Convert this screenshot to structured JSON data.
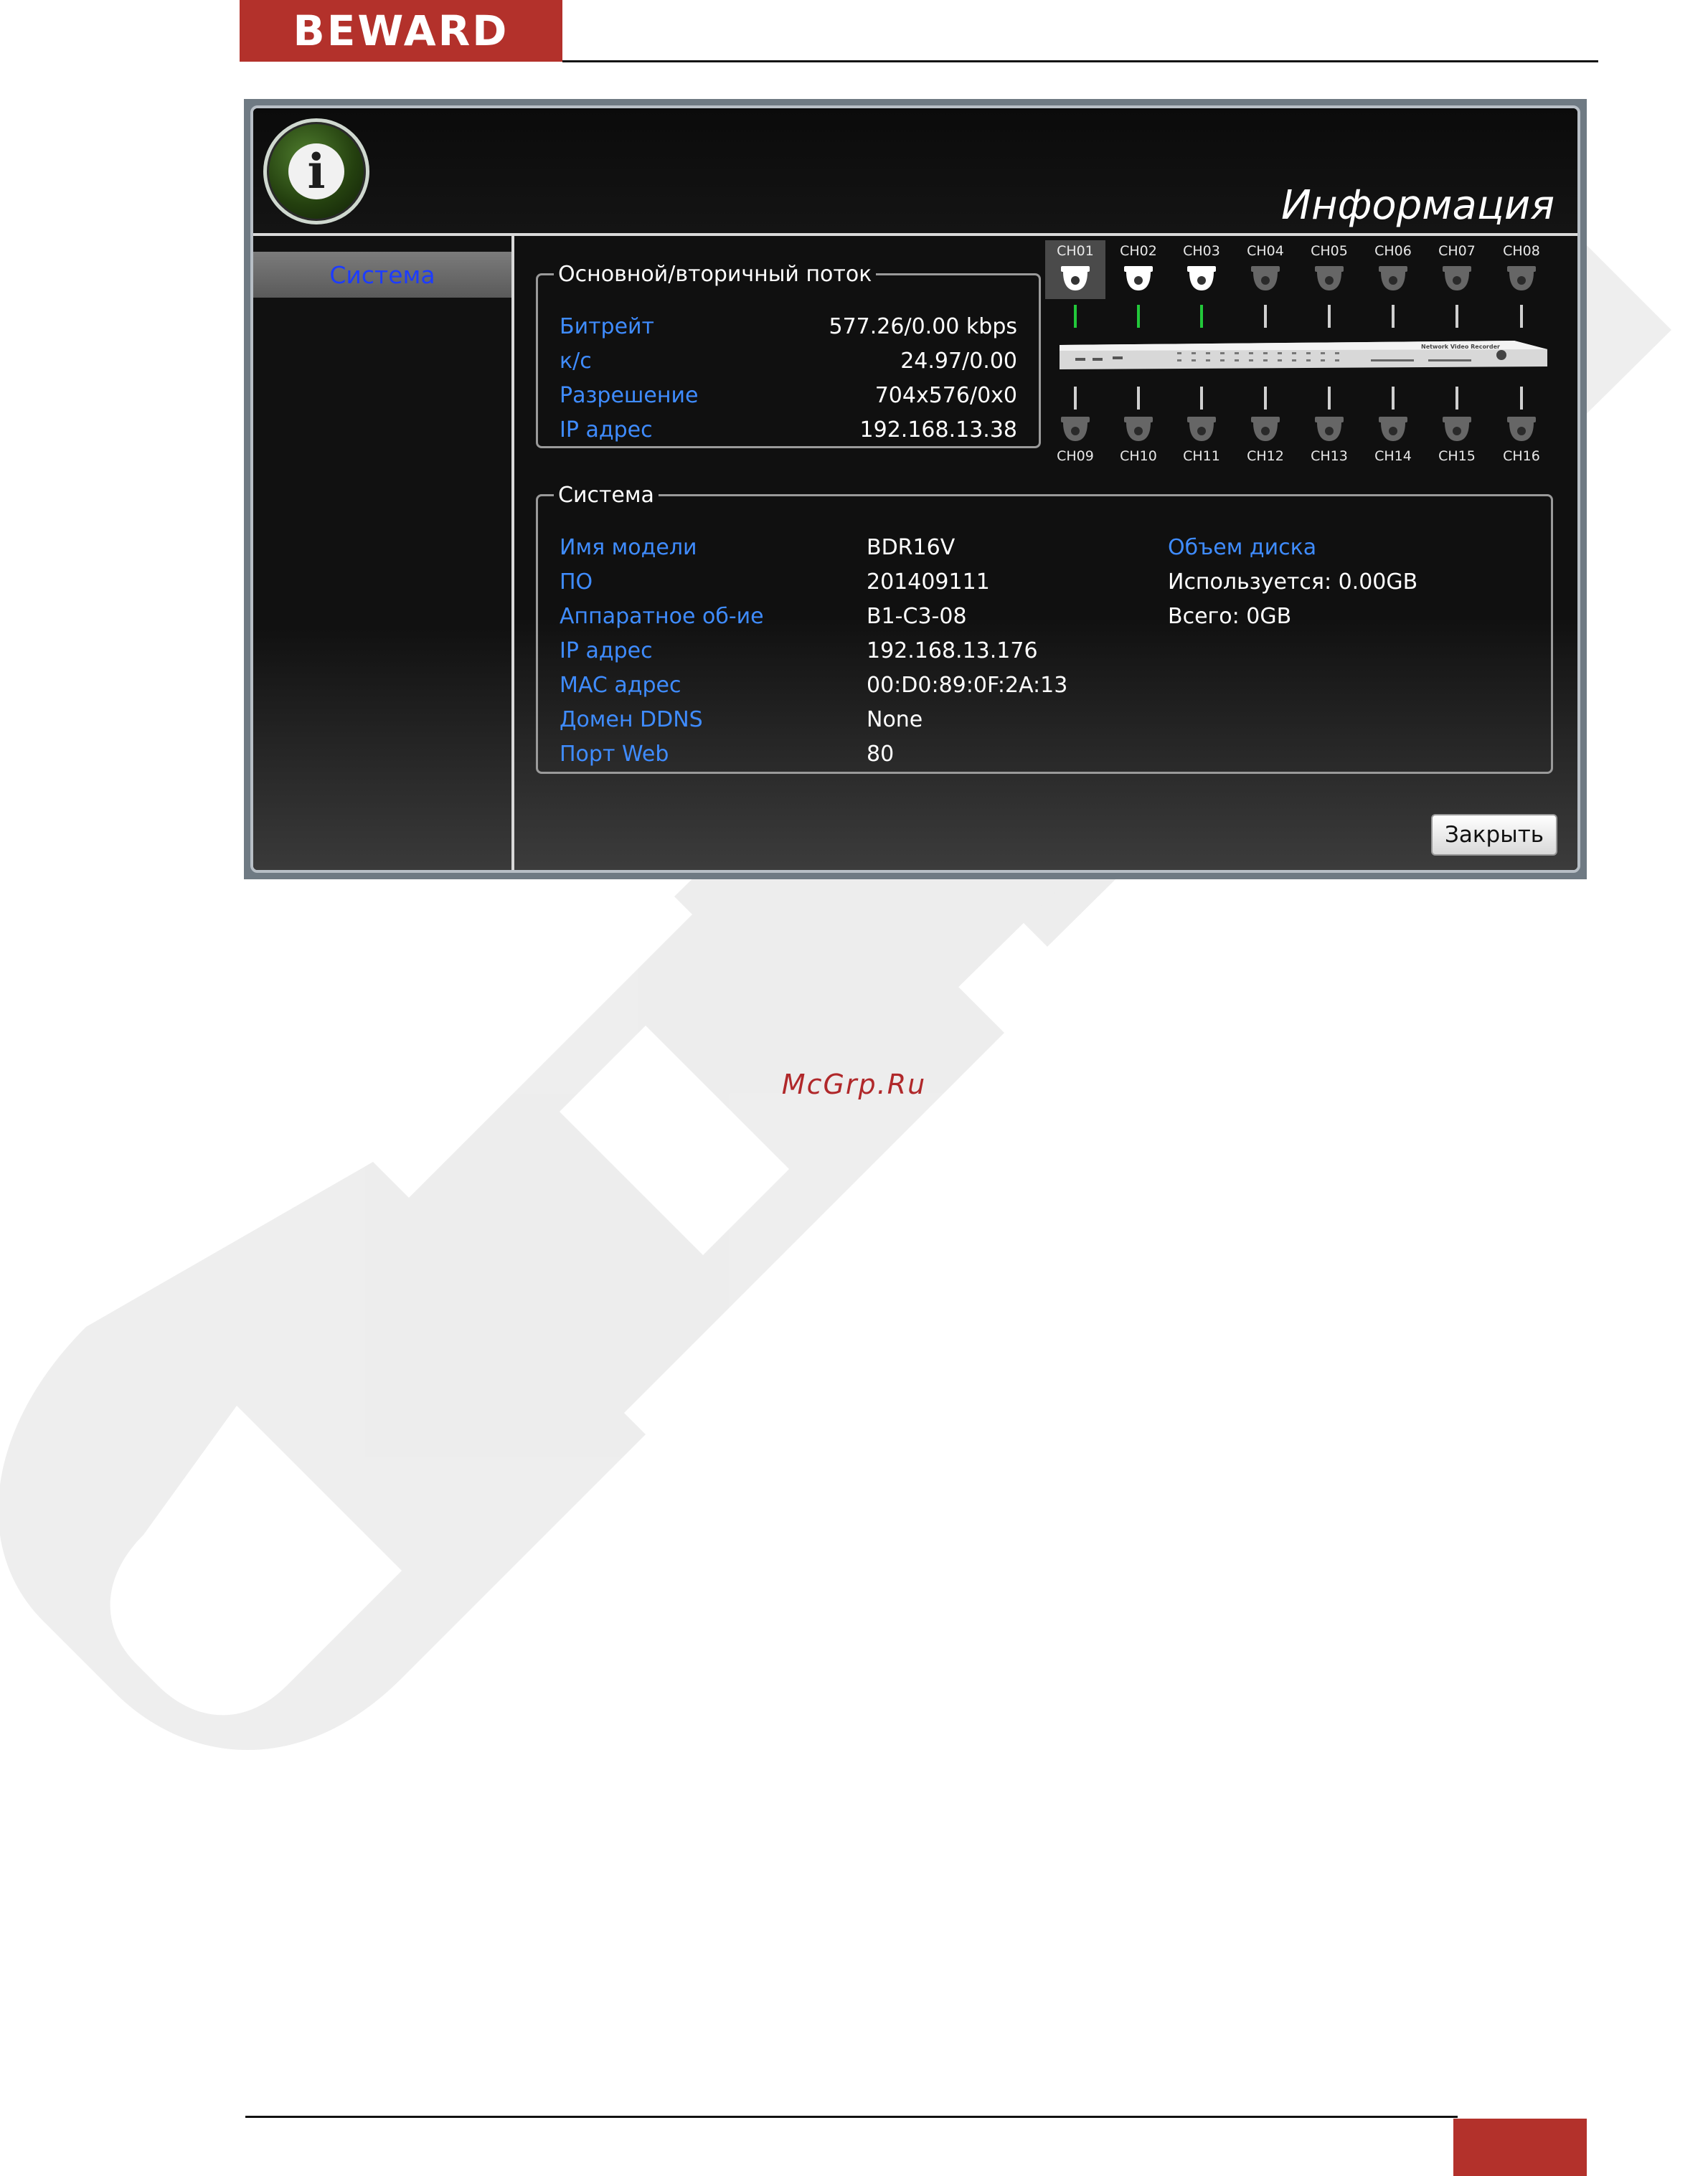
{
  "header": {
    "brand": "BEWARD"
  },
  "footer": {
    "site_link": "McGrp.Ru"
  },
  "window": {
    "title": "Информация",
    "icon_name": "info-icon",
    "sidebar": {
      "items": [
        {
          "label": "Система",
          "selected": true
        }
      ]
    },
    "stream": {
      "legend": "Основной/вторичный поток",
      "rows": [
        {
          "label": "Битрейт",
          "value": "577.26/0.00 kbps"
        },
        {
          "label": "к/с",
          "value": "24.97/0.00"
        },
        {
          "label": "Разрешение",
          "value": "704x576/0x0"
        },
        {
          "label": "IP адрес",
          "value": "192.168.13.38"
        }
      ]
    },
    "channels": {
      "top": [
        "CH01",
        "CH02",
        "CH03",
        "CH04",
        "CH05",
        "CH06",
        "CH07",
        "CH08"
      ],
      "bottom": [
        "CH09",
        "CH10",
        "CH11",
        "CH12",
        "CH13",
        "CH14",
        "CH15",
        "CH16"
      ],
      "active": [
        "CH01",
        "CH02",
        "CH03"
      ],
      "nvr_label": "Network Video Recorder"
    },
    "system": {
      "legend": "Система",
      "rows": [
        {
          "label": "Имя модели",
          "value": "BDR16V"
        },
        {
          "label": "ПО",
          "value": "201409111"
        },
        {
          "label": "Аппаратное об-ие",
          "value": "B1-C3-08"
        },
        {
          "label": "IP адрес",
          "value": "192.168.13.176"
        },
        {
          "label": "MAC адрес",
          "value": "00:D0:89:0F:2A:13"
        },
        {
          "label": "Домен DDNS",
          "value": "None"
        },
        {
          "label": "Порт Web",
          "value": "80"
        }
      ],
      "disk": {
        "label": "Объем диска",
        "used": "Используется: 0.00GB",
        "total": "Всего: 0GB"
      }
    },
    "close_label": "Закрыть"
  },
  "colors": {
    "accent": "#3f8cff",
    "brand": "#b3312b",
    "active_link": "#22c83a",
    "sidebar_selected_text": "#1d3cff"
  }
}
